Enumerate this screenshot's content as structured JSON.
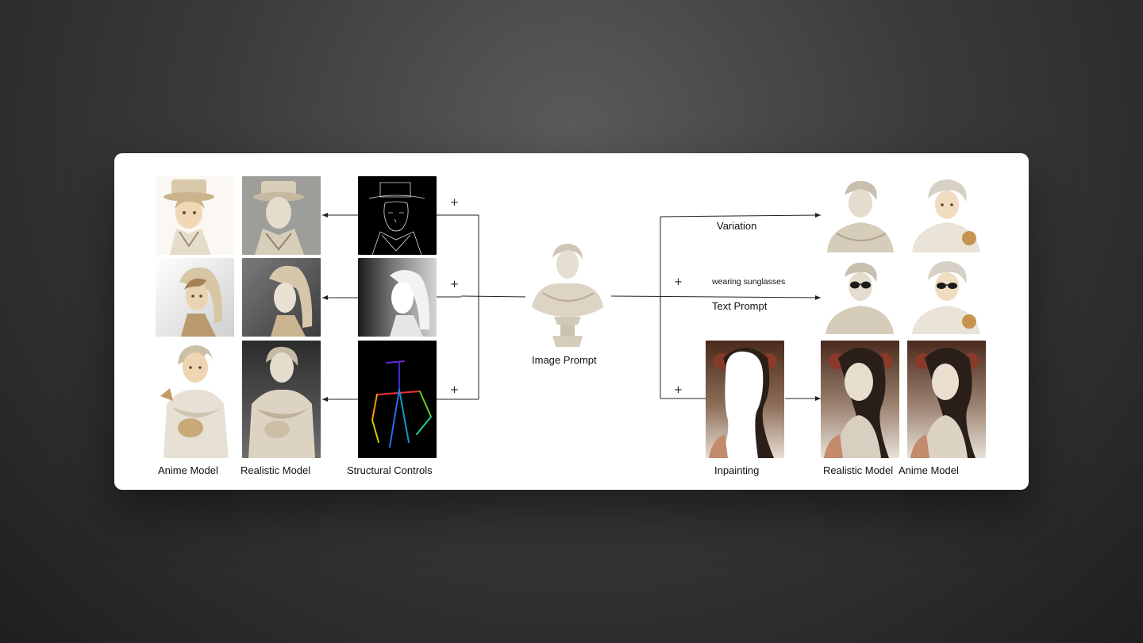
{
  "captions": {
    "anime_model_left": "Anime Model",
    "realistic_model_left": "Realistic Model",
    "structural_controls": "Structural Controls",
    "image_prompt": "Image Prompt",
    "variation": "Variation",
    "wearing_sunglasses": "wearing sunglasses",
    "text_prompt": "Text Prompt",
    "inpainting": "Inpainting",
    "realistic_model_right": "Realistic Model",
    "anime_model_right": "Anime Model"
  },
  "plus_sign": "+",
  "colors": {
    "background": "#2e2e2e",
    "card": "#ffffff",
    "line": "#222222",
    "marble": "#e8e0d2",
    "marble_shadow": "#b8ab96",
    "skin_warm": "#d9b48a",
    "pose_colors": [
      "#3a2bd8",
      "#e33",
      "#f90",
      "#2c8",
      "#2a6cf0",
      "#6c2"
    ]
  }
}
